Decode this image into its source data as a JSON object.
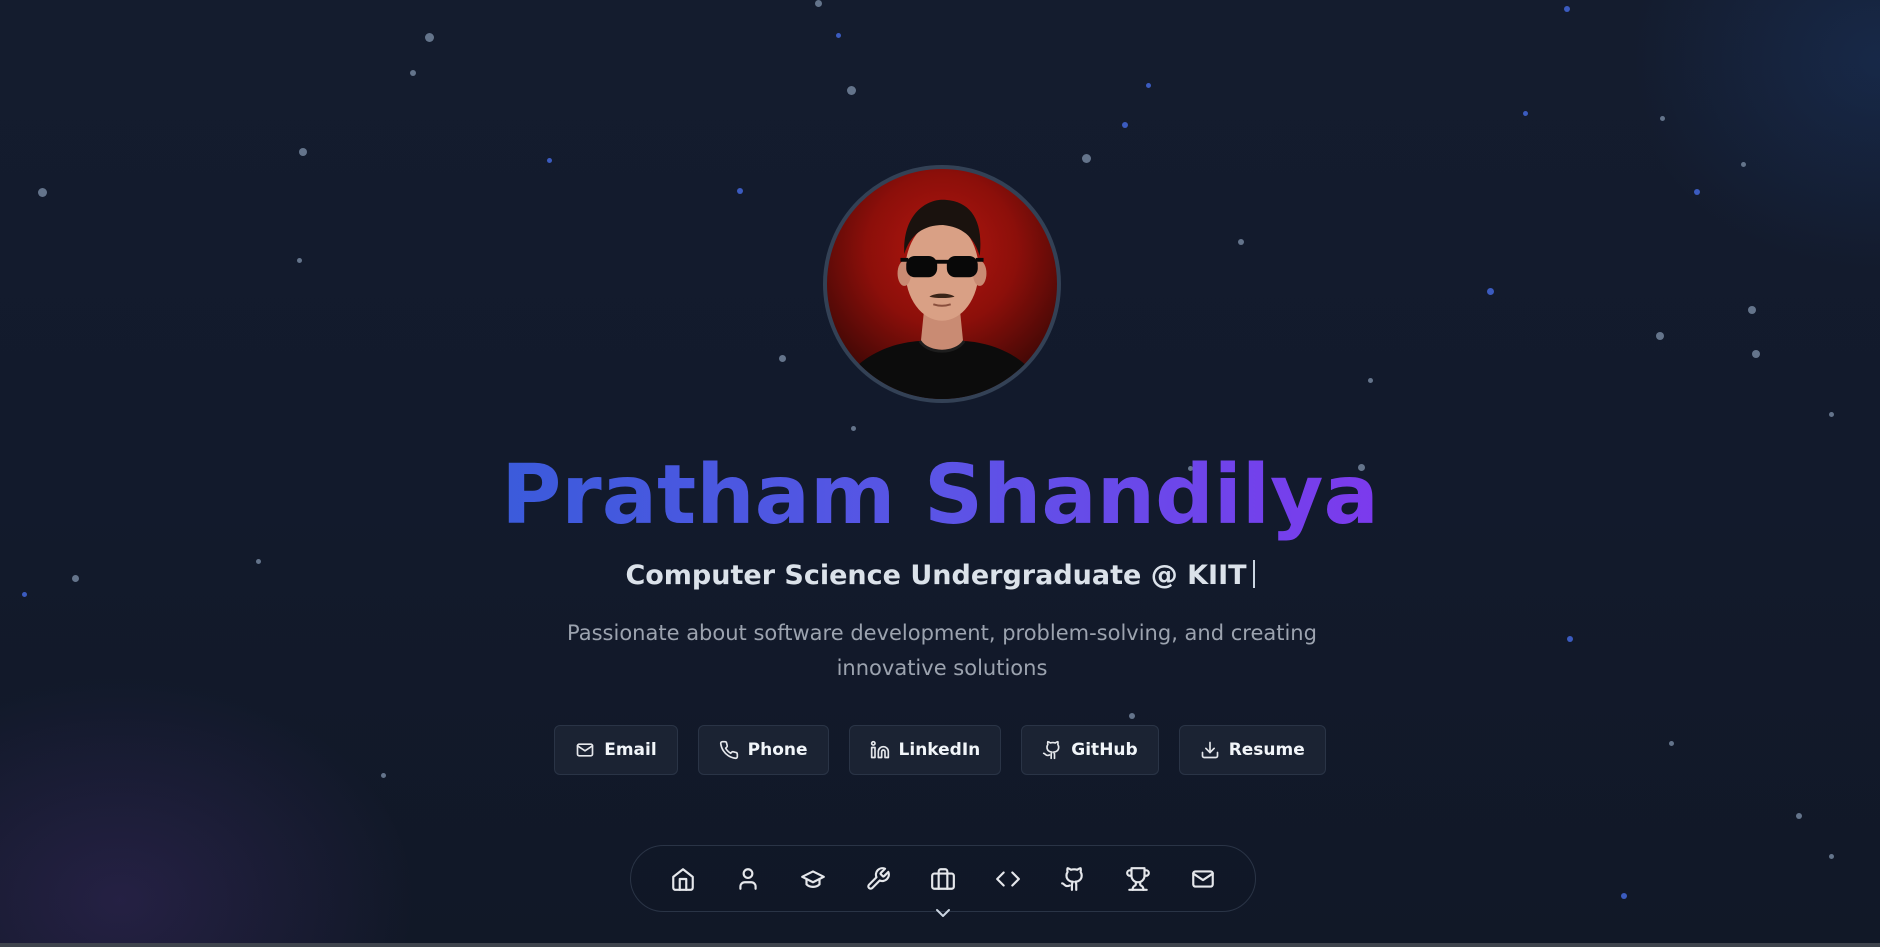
{
  "profile": {
    "name": "Pratham Shandilya",
    "title": "Computer Science Undergraduate @ KIIT",
    "tagline": "Passionate about software development, problem-solving, and creating innovative solutions"
  },
  "links": [
    {
      "label": "Email",
      "icon": "mail-icon"
    },
    {
      "label": "Phone",
      "icon": "phone-icon"
    },
    {
      "label": "LinkedIn",
      "icon": "linkedin-icon"
    },
    {
      "label": "GitHub",
      "icon": "github-icon"
    },
    {
      "label": "Resume",
      "icon": "download-icon"
    }
  ],
  "nav": [
    {
      "icon": "home-icon"
    },
    {
      "icon": "user-icon"
    },
    {
      "icon": "graduation-cap-icon"
    },
    {
      "icon": "wrench-icon"
    },
    {
      "icon": "briefcase-icon"
    },
    {
      "icon": "code-icon"
    },
    {
      "icon": "github-icon"
    },
    {
      "icon": "trophy-icon"
    },
    {
      "icon": "mail-icon"
    }
  ],
  "colors": {
    "background": "#111827",
    "name_gradient_start": "#3b5bdb",
    "name_gradient_end": "#7c3aed",
    "button_bg": "#1b2333",
    "text_light": "#f1f5f9",
    "text_muted": "#9ca3af"
  }
}
